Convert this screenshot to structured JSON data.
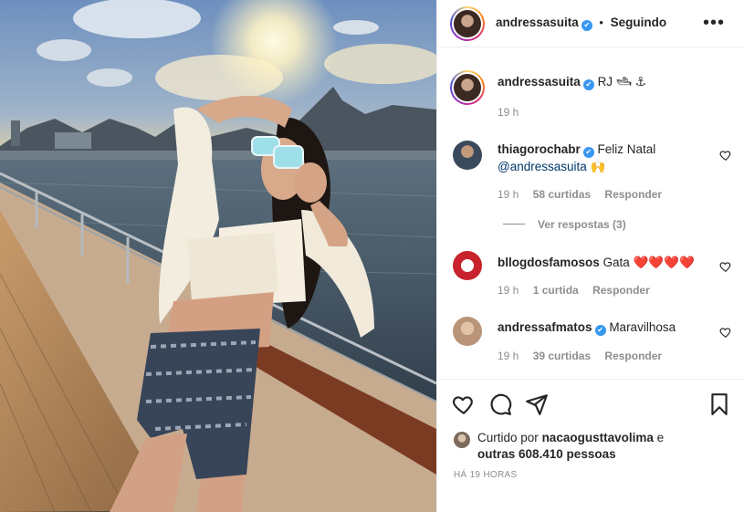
{
  "post": {
    "username": "andressasuita",
    "separator": "•",
    "follow_status": "Seguindo",
    "more_icon": "more-horizontal-icon"
  },
  "caption": {
    "username": "andressasuita",
    "text": "RJ 🛥 ⚓",
    "time": "19 h"
  },
  "comments": [
    {
      "username": "thiagorochabr",
      "verified": true,
      "text": "Feliz Natal",
      "mention": "@andressasuita",
      "emoji": "🙌",
      "time": "19 h",
      "likes": "58 curtidas",
      "reply": "Responder",
      "view_replies": "Ver respostas (3)"
    },
    {
      "username": "bllogdosfamosos",
      "verified": false,
      "text": "Gata ❤️❤️❤️❤️",
      "time": "19 h",
      "likes": "1 curtida",
      "reply": "Responder"
    },
    {
      "username": "andressafmatos",
      "verified": true,
      "text": "Maravilhosa",
      "time": "19 h",
      "likes": "39 curtidas",
      "reply": "Responder"
    }
  ],
  "likes": {
    "prefix": "Curtido por",
    "user": "nacaogusttavolima",
    "connector": "e",
    "others": "outras 608.410 pessoas"
  },
  "timestamp": "HÁ 19 HORAS",
  "colors": {
    "verified": "#3897f0",
    "muted": "#8e8e8e",
    "text": "#262626",
    "link": "#00376b"
  }
}
